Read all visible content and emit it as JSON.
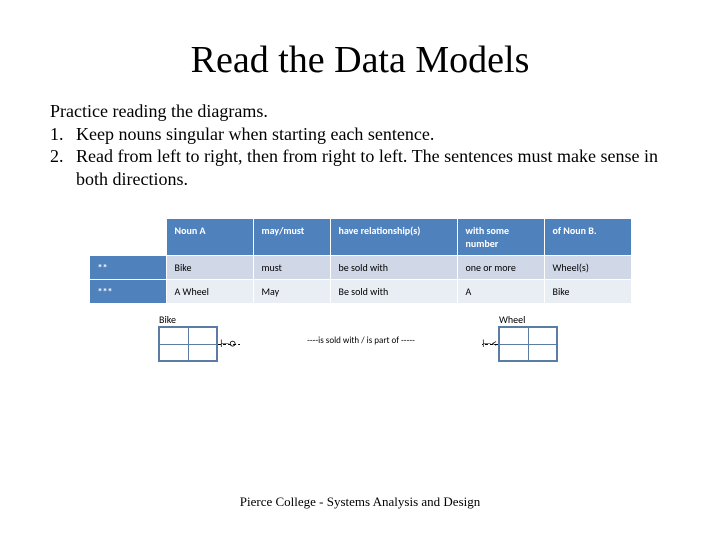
{
  "title": "Read the Data Models",
  "intro": "Practice reading the diagrams.",
  "list": {
    "n1": "1.",
    "i1": "Keep nouns singular when starting each sentence.",
    "n2": "2.",
    "i2": "Read from left to right, then from right to left.  The sentences must make sense in both directions."
  },
  "table": {
    "header": {
      "c1": "Noun A",
      "c2": "may/must",
      "c3": "have relationship(s)",
      "c4": "with some number",
      "c5": "of Noun B."
    },
    "row1": {
      "key": "**",
      "c1": "Bike",
      "c2": "must",
      "c3": "be sold with",
      "c4": "one or more",
      "c5": "Wheel(s)"
    },
    "row2": {
      "key": "***",
      "c1": "A Wheel",
      "c2": "May",
      "c3": "Be sold with",
      "c4": "A",
      "c5": "Bike"
    }
  },
  "erd": {
    "entityA": "Bike",
    "entityB": "Wheel",
    "relationship": "----is sold with / is part of -----",
    "leftNotation": "⊢○",
    "rightNotation": "⊢<"
  },
  "footer": "Pierce College - Systems Analysis and Design"
}
